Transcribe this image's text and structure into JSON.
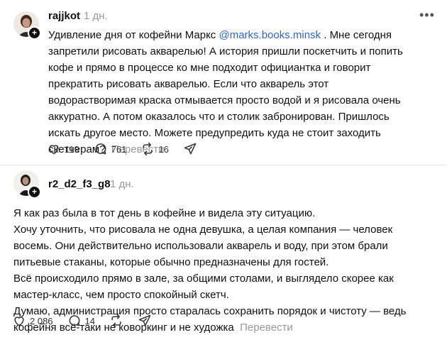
{
  "posts": [
    {
      "username": "rajjkot",
      "time": "1 дн.",
      "text_before_mention": "Удивление дня от кофейни Маркс ",
      "mention": "@marks.books.minsk",
      "text_after_mention": " . Мне сегодня запретили рисовать акварелью! А история пришли поскетчить и попить кофе и прямо в процессе ко мне подходит официантка и говорит прекратить рисовать акварелью. Если что акварель этот водорастворимая краска отмывается просто водой и я рисовала очень аккуратно. А потом оказалось что и столик забронирован. Пришлось искать другое место. Можете предупредить куда не стоит заходить скетчерам?",
      "translate_label": "Перевести",
      "likes": "119",
      "comments": "761",
      "reposts": "16"
    },
    {
      "username": "r2_d2_f3_g8",
      "time": "1 дн.",
      "lines": [
        "Я как раз была в тот день в кофейне и видела эту ситуацию.",
        "Хочу уточнить, что рисовала не одна девушка, а целая компания — человек восемь. Они действительно использовали акварель и воду, при этом брали питьевые стаканы, которые обычно предназначены для гостей.",
        "Всё происходило прямо в зале, за общими столами, и выглядело скорее как мастер-класс, чем просто спокойный скетч.",
        "Думаю, администрация просто старалась сохранить порядок и чистоту — ведь кофейня всё-таки не коворкинг и не художка"
      ],
      "translate_label": "Перевести",
      "likes": "2 086",
      "comments": "14",
      "reposts": ""
    }
  ],
  "icons": {
    "like": "heart-icon",
    "comment": "comment-bubble-icon",
    "repost": "repost-icon",
    "share": "share-send-icon",
    "more": "more-dots-icon",
    "follow": "plus-icon"
  },
  "colors": {
    "text": "#101010",
    "muted": "#999999",
    "mention": "#2f66c8",
    "divider": "#e3e3e3"
  }
}
